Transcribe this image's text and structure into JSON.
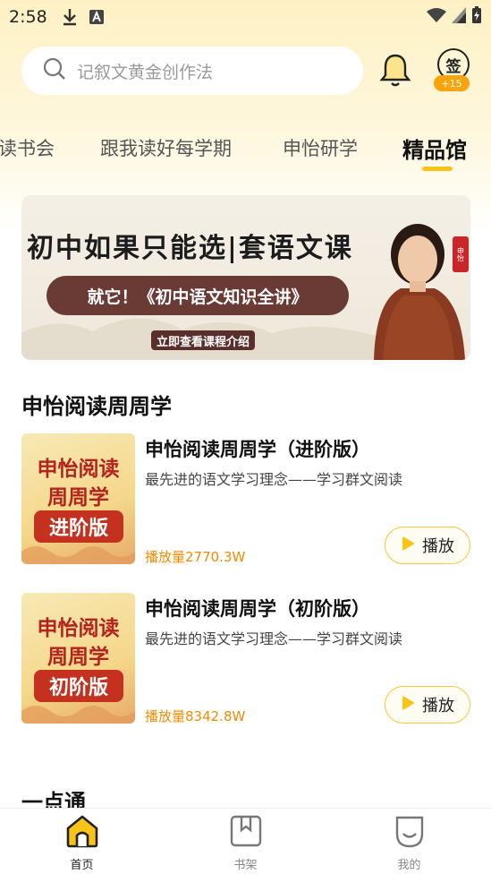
{
  "status_bar": {
    "time": "2:58"
  },
  "search": {
    "placeholder": "记叙文黄金创作法"
  },
  "signin": {
    "label": "签",
    "badge": "+15"
  },
  "tabs": [
    {
      "label": "读书会"
    },
    {
      "label": "跟我读好每学期"
    },
    {
      "label": "申怡研学"
    },
    {
      "label": "精品馆",
      "active": true
    }
  ],
  "banner": {
    "headline": "初中如果只能选|套语文课",
    "subline": "就它！《初中语文知识全讲》",
    "cta": "立即查看课程介绍",
    "seal": "申怡"
  },
  "section": {
    "title": "申怡阅读周周学",
    "courses": [
      {
        "title": "申怡阅读周周学（进阶版）",
        "desc": "最先进的语文学习理念——学习群文阅读",
        "plays": "播放量2770.3W",
        "button": "播放",
        "cover_line1": "申怡阅读",
        "cover_line2": "周周学",
        "cover_level": "进阶版"
      },
      {
        "title": "申怡阅读周周学（初阶版）",
        "desc": "最先进的语文学习理念——学习群文阅读",
        "plays": "播放量8342.8W",
        "button": "播放",
        "cover_line1": "申怡阅读",
        "cover_line2": "周周学",
        "cover_level": "初阶版"
      }
    ]
  },
  "section2": {
    "title": "一点通"
  },
  "bottom_nav": [
    {
      "label": "首页",
      "icon": "home-icon",
      "active": true
    },
    {
      "label": "书架",
      "icon": "bookshelf-icon"
    },
    {
      "label": "我的",
      "icon": "profile-icon"
    }
  ],
  "colors": {
    "accent": "#f8c419",
    "play_count": "#f08a00",
    "cover_red": "#c4321f"
  }
}
